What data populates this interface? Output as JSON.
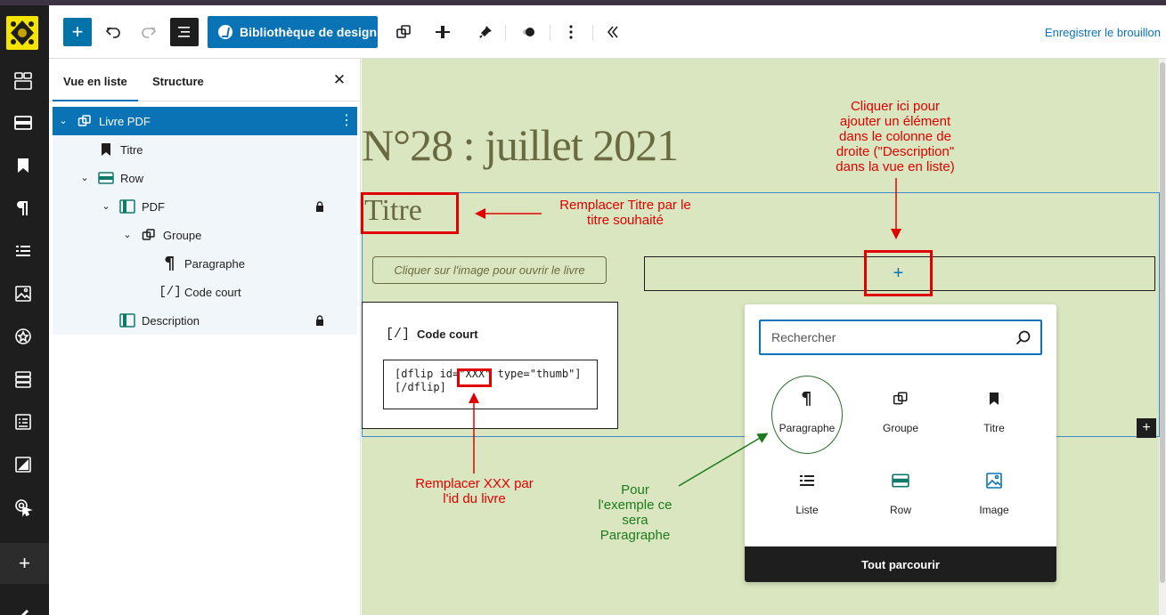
{
  "toolbar": {
    "design_library_label": "Bibliothèque de design",
    "save_draft_label": "Enregistrer le brouillon",
    "icons": [
      "plus-icon",
      "undo-icon",
      "redo-icon",
      "list-view-icon",
      "design-library-icon",
      "duplicate-icon",
      "align-icon",
      "tools-icon",
      "toggle-icon",
      "more-icon",
      "collapse-icon"
    ]
  },
  "panel": {
    "tabs": [
      "Vue en liste",
      "Structure"
    ],
    "tree": [
      {
        "label": "Livre PDF",
        "icon": "group-icon",
        "expanded": true,
        "selected": true
      },
      {
        "label": "Titre",
        "icon": "bookmark-icon"
      },
      {
        "label": "Row",
        "icon": "row-icon",
        "expanded": true
      },
      {
        "label": "PDF",
        "icon": "column-icon",
        "expanded": true,
        "locked": true
      },
      {
        "label": "Groupe",
        "icon": "group-icon",
        "expanded": true
      },
      {
        "label": "Paragraphe",
        "icon": "paragraph-icon"
      },
      {
        "label": "Code court",
        "icon": "shortcode-icon"
      },
      {
        "label": "Description",
        "icon": "column-icon",
        "locked": true
      }
    ]
  },
  "canvas": {
    "heading": "N°28 : juillet 2021",
    "title_placeholder": "Titre",
    "button_text": "Cliquer sur l'image pour ouvrir le livre",
    "shortcode": {
      "icon_glyph": "[/]",
      "title": "Code court",
      "line1_a": "[dflip id=",
      "line1_id": "\"XXX\"",
      "line1_b": " type=\"thumb\"]",
      "line2": "[/dflip]"
    },
    "add_block_glyph": "+"
  },
  "inserter": {
    "search_placeholder": "Rechercher",
    "items": [
      {
        "label": "Paragraphe",
        "icon": "paragraph-icon"
      },
      {
        "label": "Groupe",
        "icon": "group-icon"
      },
      {
        "label": "Titre",
        "icon": "bookmark-icon"
      },
      {
        "label": "Liste",
        "icon": "list-icon"
      },
      {
        "label": "Row",
        "icon": "row-icon"
      },
      {
        "label": "Image",
        "icon": "image-icon"
      }
    ],
    "browse_all_label": "Tout parcourir"
  },
  "annotations": {
    "add_here": "Cliquer ici pour ajouter un élément dans le colonne de droite (\"Description\" dans la vue en liste)",
    "add_here_lines": [
      "Cliquer ici pour",
      "ajouter un élément",
      "dans le colonne de",
      "droite (\"Description\"",
      "dans la vue en liste)"
    ],
    "replace_title": "Remplacer Titre par le titre souhaité",
    "replace_title_lines": [
      "Remplacer Titre par le",
      "titre souhaité"
    ],
    "replace_xxx": "Remplacer XXX par l'id du livre",
    "replace_xxx_lines": [
      "Remplacer XXX par",
      "l'id du livre"
    ],
    "example": "Pour l'exemple ce sera Paragraphe",
    "example_lines": [
      "Pour",
      "l'exemple ce",
      "sera",
      "Paragraphe"
    ]
  },
  "colors": {
    "accent": "#0a73b5",
    "canvas_bg": "#d9e6bf",
    "annotation_red": "#e00000",
    "annotation_green": "#1d7a1d"
  }
}
